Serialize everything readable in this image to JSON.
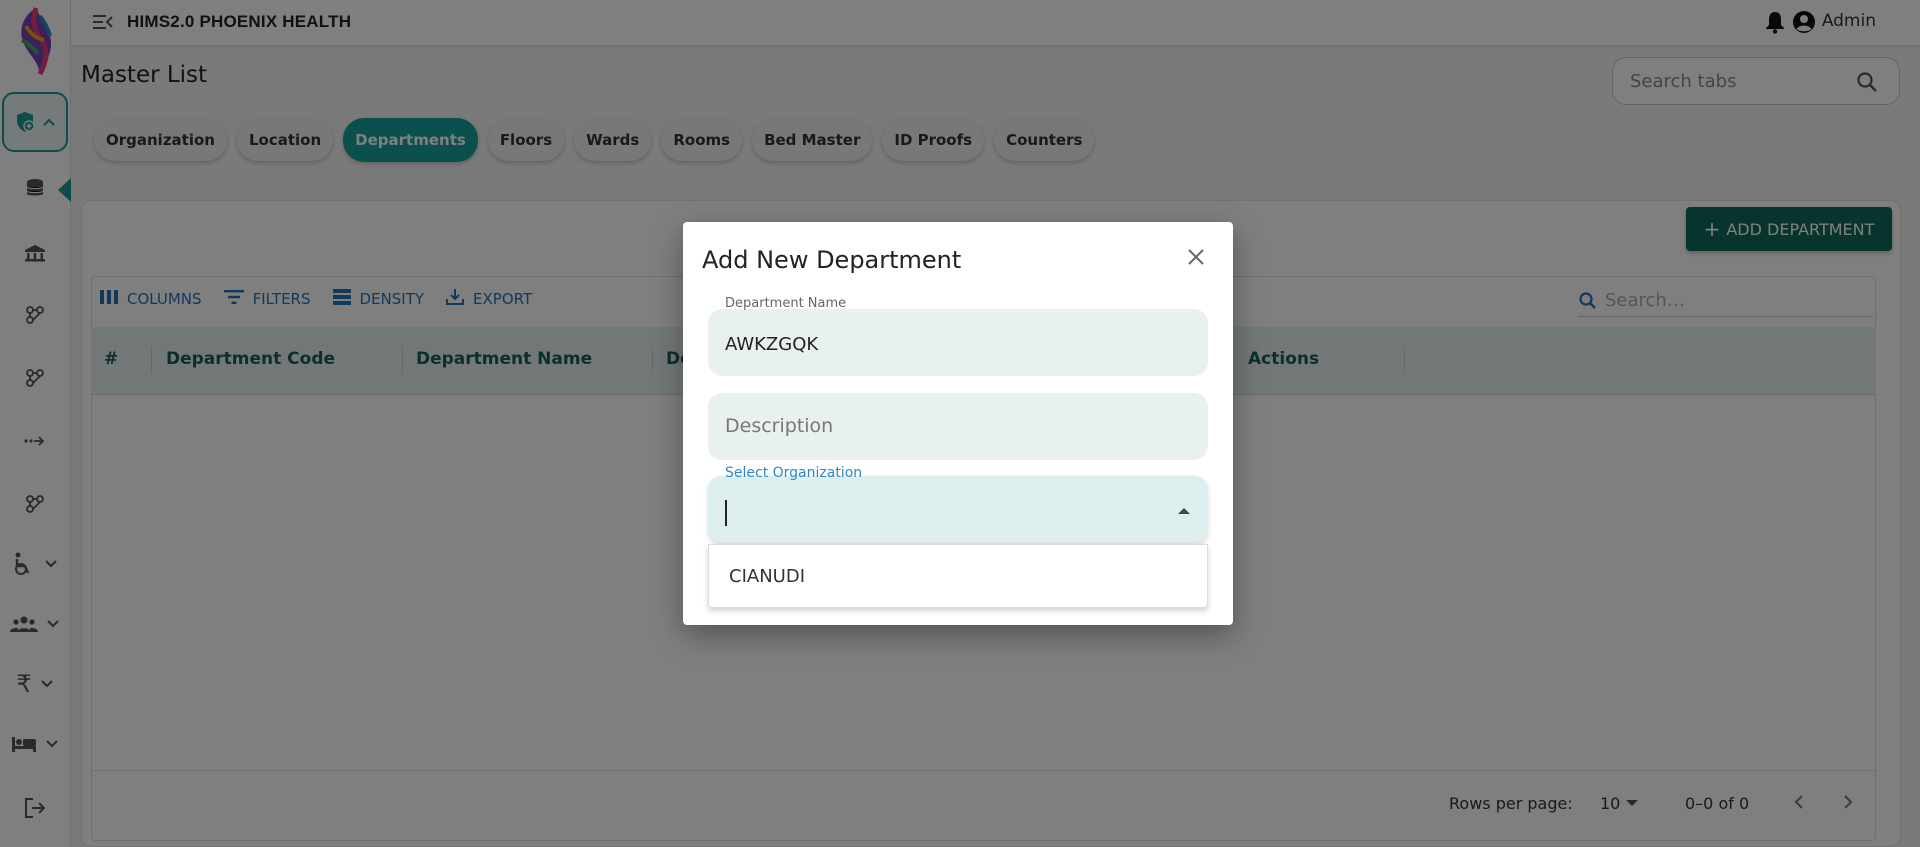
{
  "app": {
    "title": "HIMS2.0 PHOENIX HEALTH",
    "user": "Admin"
  },
  "sidebar": {
    "icons": [
      "hospital-icon",
      "database-icon",
      "building-icon",
      "hub-icon",
      "hub-icon",
      "transfer-icon",
      "hub-icon",
      "wheelchair-icon",
      "people-icon",
      "rupee-icon",
      "bed-icon",
      "logout-icon"
    ],
    "accent": "#1a9a92"
  },
  "page": {
    "title": "Master List",
    "search_tabs_placeholder": "Search tabs",
    "tabs": [
      {
        "label": "Organization"
      },
      {
        "label": "Location"
      },
      {
        "label": "Departments",
        "active": true
      },
      {
        "label": "Floors"
      },
      {
        "label": "Wards"
      },
      {
        "label": "Rooms"
      },
      {
        "label": "Bed Master"
      },
      {
        "label": "ID Proofs"
      },
      {
        "label": "Counters"
      }
    ]
  },
  "grid": {
    "add_button": "ADD DEPARTMENT",
    "toolbar": {
      "columns": "COLUMNS",
      "filters": "FILTERS",
      "density": "DENSITY",
      "export": "EXPORT"
    },
    "search_placeholder": "Search…",
    "columns": [
      "#",
      "Department Code",
      "Department Name",
      "De",
      "Actions"
    ],
    "footer": {
      "rows_per_page_label": "Rows per page:",
      "rows_per_page": "10",
      "range": "0–0 of 0"
    }
  },
  "modal": {
    "title": "Add New Department",
    "department_name_label": "Department Name",
    "department_name_value": "AWKZGQK",
    "description_placeholder": "Description",
    "organization_label": "Select Organization",
    "organization_options": [
      "CIANUDI"
    ]
  },
  "colors": {
    "primary": "#16a198",
    "primary_dark": "#0f6a5c",
    "link": "#2570b7"
  }
}
